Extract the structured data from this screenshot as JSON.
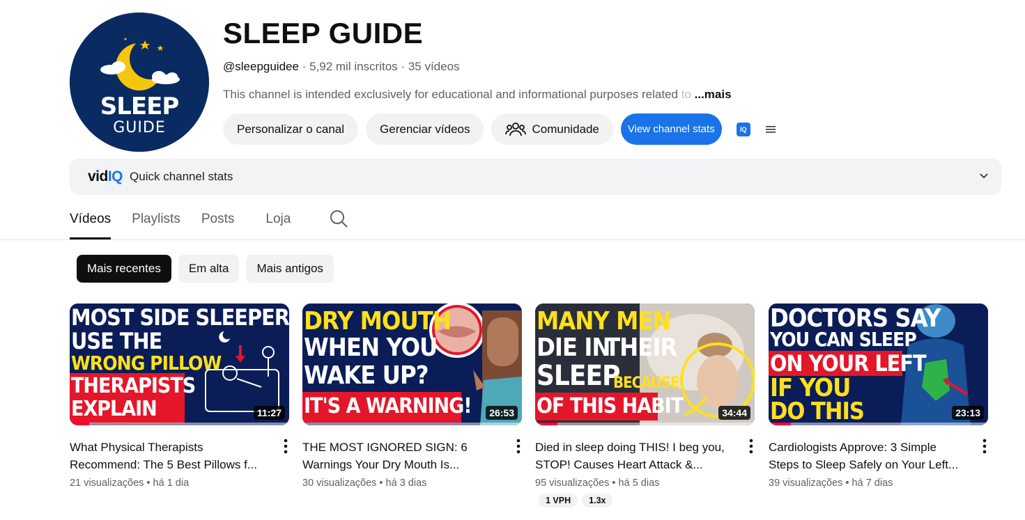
{
  "channel": {
    "name": "SLEEP GUIDE",
    "handle": "@sleepguidee",
    "subscribers": "5,92 mil inscritos",
    "videos_count": "35 vídeos",
    "description": "This channel is intended exclusively for educational and informational purposes related",
    "description_fade": " to",
    "more": "...mais",
    "avatar_text_1": "SLEEP",
    "avatar_text_2": "GUIDE"
  },
  "actions": {
    "customize": "Personalizar o canal",
    "manage": "Gerenciar vídeos",
    "community": "Comunidade",
    "stats": "View channel stats",
    "iq_badge": "IQ"
  },
  "vidiq": {
    "logo_vid": "vid",
    "logo_iq": "IQ",
    "label": "Quick channel stats"
  },
  "tabs": [
    "Vídeos",
    "Playlists",
    "Posts",
    "Loja"
  ],
  "chips": [
    "Mais recentes",
    "Em alta",
    "Mais antigos"
  ],
  "videos": [
    {
      "title_1": "What Physical Therapists",
      "title_2": "Recommend: The 5 Best Pillows f...",
      "views": "21 visualizações",
      "age": "há 1 dia",
      "duration": "11:27",
      "thumb": [
        "MOST SIDE SLEEPERS",
        "USE THE",
        "WRONG PILLOW",
        "THERAPISTS",
        "EXPLAIN"
      ]
    },
    {
      "title_1": "THE MOST IGNORED SIGN: 6",
      "title_2": "Warnings Your Dry Mouth Is...",
      "views": "30 visualizações",
      "age": "há 3 dias",
      "duration": "26:53",
      "thumb": [
        "DRY MOUTH",
        "WHEN YOU",
        "WAKE UP?",
        "IT'S A WARNING!"
      ]
    },
    {
      "title_1": "Died in sleep doing THIS! I beg you,",
      "title_2": "STOP! Causes Heart Attack &...",
      "views": "95 visualizações",
      "age": "há 5 dias",
      "duration": "34:44",
      "badges": [
        "1 VPH",
        "1.3x"
      ],
      "thumb": [
        "MANY MEN",
        "DIE IN",
        "THEIR",
        "SLEEP",
        "BECAUSE",
        "OF THIS HABIT"
      ]
    },
    {
      "title_1": "Cardiologists Approve: 3 Simple",
      "title_2": "Steps to Sleep Safely on Your Left...",
      "views": "39 visualizações",
      "age": "há 7 dias",
      "duration": "23:13",
      "thumb": [
        "DOCTORS SAY",
        "YOU CAN SLEEP",
        "ON YOUR LEFT",
        "IF YOU",
        "DO THIS"
      ]
    }
  ],
  "colors": {
    "accent_blue": "#1a73e8",
    "thumb_yellow": "#ffe01b",
    "thumb_red": "#e4162a",
    "thumb_navy": "#0a1f5a",
    "progress_red": "#ff0033"
  }
}
